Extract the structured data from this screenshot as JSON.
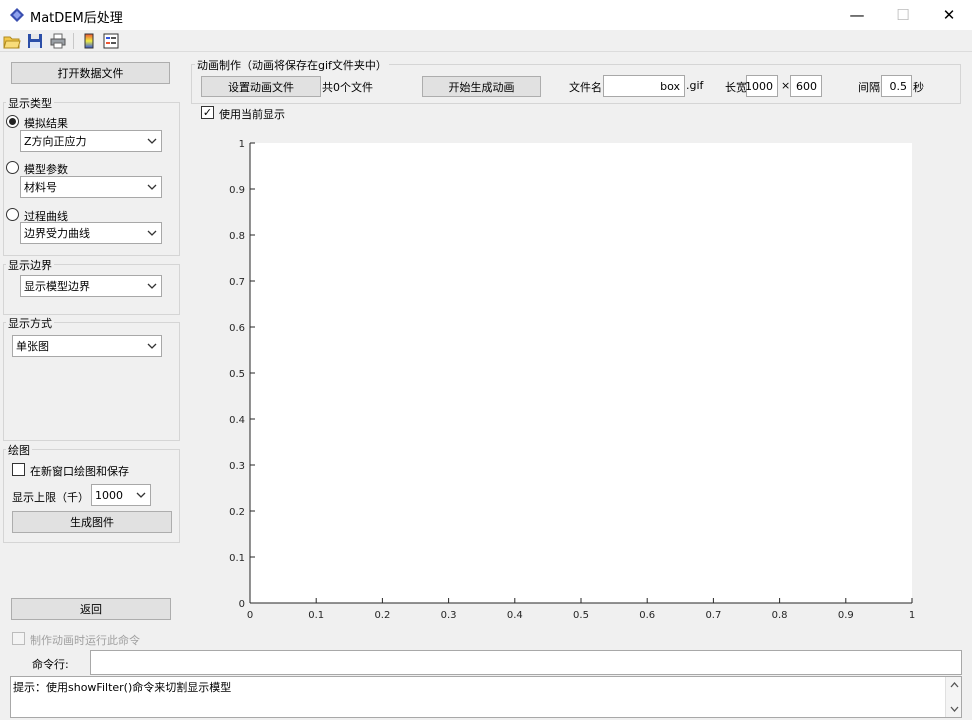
{
  "window": {
    "title": "MatDEM后处理",
    "minimize": "—",
    "maximize": "☐",
    "close": "✕"
  },
  "toolbar": {
    "icons": [
      "open-folder-icon",
      "save-icon",
      "print-icon",
      "colorbar-icon",
      "legend-icon"
    ]
  },
  "left": {
    "open_file": "打开数据文件",
    "display_type": {
      "title": "显示类型",
      "sim_result": "模拟结果",
      "sim_select": "Z方向正应力",
      "model_param": "模型参数",
      "param_select": "材料号",
      "process_curve": "过程曲线",
      "curve_select": "边界受力曲线"
    },
    "display_boundary": {
      "title": "显示边界",
      "select": "显示模型边界"
    },
    "display_mode": {
      "title": "显示方式",
      "select": "单张图"
    },
    "plot": {
      "title": "绘图",
      "new_window": "在新窗口绘图和保存",
      "upper_label": "显示上限（千）",
      "upper_value": "1000",
      "generate": "生成图件"
    },
    "back": "返回",
    "run_cmd": "制作动画时运行此命令"
  },
  "animation": {
    "title": "动画制作（动画将保存在gif文件夹中）",
    "set_file": "设置动画文件",
    "file_count": "共0个文件",
    "start": "开始生成动画",
    "filename_label": "文件名",
    "filename_value": "box",
    "ext": ".gif",
    "size_label": "长宽",
    "width": "1000",
    "times": "×",
    "height": "600",
    "interval_label": "间隔",
    "interval_value": "0.5",
    "interval_unit": "秒",
    "use_current": "使用当前显示"
  },
  "chart_data": {
    "type": "line",
    "series": [],
    "xlim": [
      0,
      1
    ],
    "ylim": [
      0,
      1
    ],
    "xticks": [
      "0",
      "0.1",
      "0.2",
      "0.3",
      "0.4",
      "0.5",
      "0.6",
      "0.7",
      "0.8",
      "0.9",
      "1"
    ],
    "yticks": [
      "0",
      "0.1",
      "0.2",
      "0.3",
      "0.4",
      "0.5",
      "0.6",
      "0.7",
      "0.8",
      "0.9",
      "1"
    ],
    "grid": false
  },
  "command": {
    "label": "命令行:",
    "value": "",
    "hint": "提示：使用showFilter()命令来切割显示模型"
  }
}
